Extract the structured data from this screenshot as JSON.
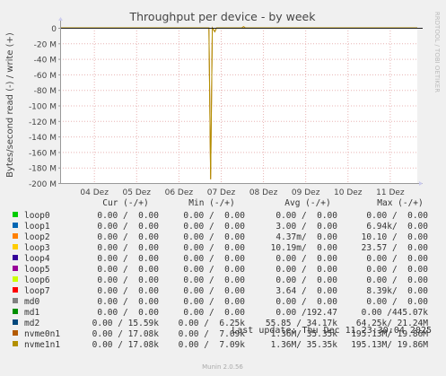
{
  "chart_data": {
    "type": "line",
    "title": "Throughput per device - by week",
    "ylabel": "Bytes/second read (-) / write (+)",
    "side_label": "RRDTOOL / TOBI OETIKER",
    "xlabel": "",
    "ylim": [
      -200,
      0
    ],
    "yticks": [
      {
        "value": 0,
        "label": "0"
      },
      {
        "value": -20,
        "label": "-20 M"
      },
      {
        "value": -40,
        "label": "-40 M"
      },
      {
        "value": -60,
        "label": "-60 M"
      },
      {
        "value": -80,
        "label": "-80 M"
      },
      {
        "value": -100,
        "label": "-100 M"
      },
      {
        "value": -120,
        "label": "-120 M"
      },
      {
        "value": -140,
        "label": "-140 M"
      },
      {
        "value": -160,
        "label": "-160 M"
      },
      {
        "value": -180,
        "label": "-180 M"
      },
      {
        "value": -200,
        "label": "-200 M"
      }
    ],
    "xrange": [
      3.2,
      11.65
    ],
    "xticks": [
      {
        "value": 4,
        "label": "04 Dez"
      },
      {
        "value": 5,
        "label": "05 Dez"
      },
      {
        "value": 6,
        "label": "06 Dez"
      },
      {
        "value": 7,
        "label": "07 Dez"
      },
      {
        "value": 8,
        "label": "08 Dez"
      },
      {
        "value": 9,
        "label": "09 Dez"
      },
      {
        "value": 10,
        "label": "10 Dez"
      },
      {
        "value": 11,
        "label": "11 Dez"
      }
    ],
    "series": [
      {
        "name": "nvme0n1",
        "color": "#b35900",
        "x": [
          3.2,
          6.72,
          6.76,
          6.8,
          6.86,
          6.9,
          7.5,
          7.54,
          7.58,
          11.65
        ],
        "y": [
          0,
          0,
          -195,
          0,
          -5,
          0,
          0,
          1.5,
          0,
          0
        ]
      },
      {
        "name": "nvme1n1",
        "color": "#b38f00",
        "x": [
          3.2,
          6.72,
          6.76,
          6.8,
          6.86,
          6.9,
          7.5,
          7.54,
          7.58,
          11.65
        ],
        "y": [
          0,
          0,
          -195,
          0,
          -5,
          0,
          0,
          1.5,
          0,
          0
        ]
      }
    ]
  },
  "legend": {
    "headers": [
      "Cur (-/+)",
      "Min (-/+)",
      "Avg (-/+)",
      "Max (-/+)"
    ],
    "rows": [
      {
        "name": "loop0",
        "color": "#00cc00",
        "cur": "0.00 /  0.00",
        "min": "0.00 /  0.00",
        "avg": "0.00 /  0.00",
        "max": "0.00 /  0.00"
      },
      {
        "name": "loop1",
        "color": "#0066b3",
        "cur": "0.00 /  0.00",
        "min": "0.00 /  0.00",
        "avg": "3.00 /  0.00",
        "max": "6.94k/  0.00"
      },
      {
        "name": "loop2",
        "color": "#ff8000",
        "cur": "0.00 /  0.00",
        "min": "0.00 /  0.00",
        "avg": "4.37m/  0.00",
        "max": "10.10 /  0.00"
      },
      {
        "name": "loop3",
        "color": "#ffcc00",
        "cur": "0.00 /  0.00",
        "min": "0.00 /  0.00",
        "avg": "10.19m/  0.00",
        "max": "23.57 /  0.00"
      },
      {
        "name": "loop4",
        "color": "#330099",
        "cur": "0.00 /  0.00",
        "min": "0.00 /  0.00",
        "avg": "0.00 /  0.00",
        "max": "0.00 /  0.00"
      },
      {
        "name": "loop5",
        "color": "#990099",
        "cur": "0.00 /  0.00",
        "min": "0.00 /  0.00",
        "avg": "0.00 /  0.00",
        "max": "0.00 /  0.00"
      },
      {
        "name": "loop6",
        "color": "#ccff00",
        "cur": "0.00 /  0.00",
        "min": "0.00 /  0.00",
        "avg": "0.00 /  0.00",
        "max": "0.00 /  0.00"
      },
      {
        "name": "loop7",
        "color": "#ff0000",
        "cur": "0.00 /  0.00",
        "min": "0.00 /  0.00",
        "avg": "3.64 /  0.00",
        "max": "8.39k/  0.00"
      },
      {
        "name": "md0",
        "color": "#808080",
        "cur": "0.00 /  0.00",
        "min": "0.00 /  0.00",
        "avg": "0.00 /  0.00",
        "max": "0.00 /  0.00"
      },
      {
        "name": "md1",
        "color": "#008f00",
        "cur": "0.00 /  0.00",
        "min": "0.00 /  0.00",
        "avg": "0.00 /192.47",
        "max": "0.00 /445.07k"
      },
      {
        "name": "md2",
        "color": "#00487d",
        "cur": "0.00 / 15.59k",
        "min": "0.00 /  6.25k",
        "avg": "55.85 / 34.17k",
        "max": "64.25k/ 21.24M"
      },
      {
        "name": "nvme0n1",
        "color": "#b35a00",
        "cur": "0.00 / 17.08k",
        "min": "0.00 /  7.09k",
        "avg": "1.36M/ 35.35k",
        "max": "195.13M/ 19.86M"
      },
      {
        "name": "nvme1n1",
        "color": "#b38f00",
        "cur": "0.00 / 17.08k",
        "min": "0.00 /  7.09k",
        "avg": "1.36M/ 35.35k",
        "max": "195.13M/ 19.86M"
      }
    ]
  },
  "last_update": "Last update: Thu Dec 11 23:30:04 2025",
  "footer": "Munin 2.0.56"
}
